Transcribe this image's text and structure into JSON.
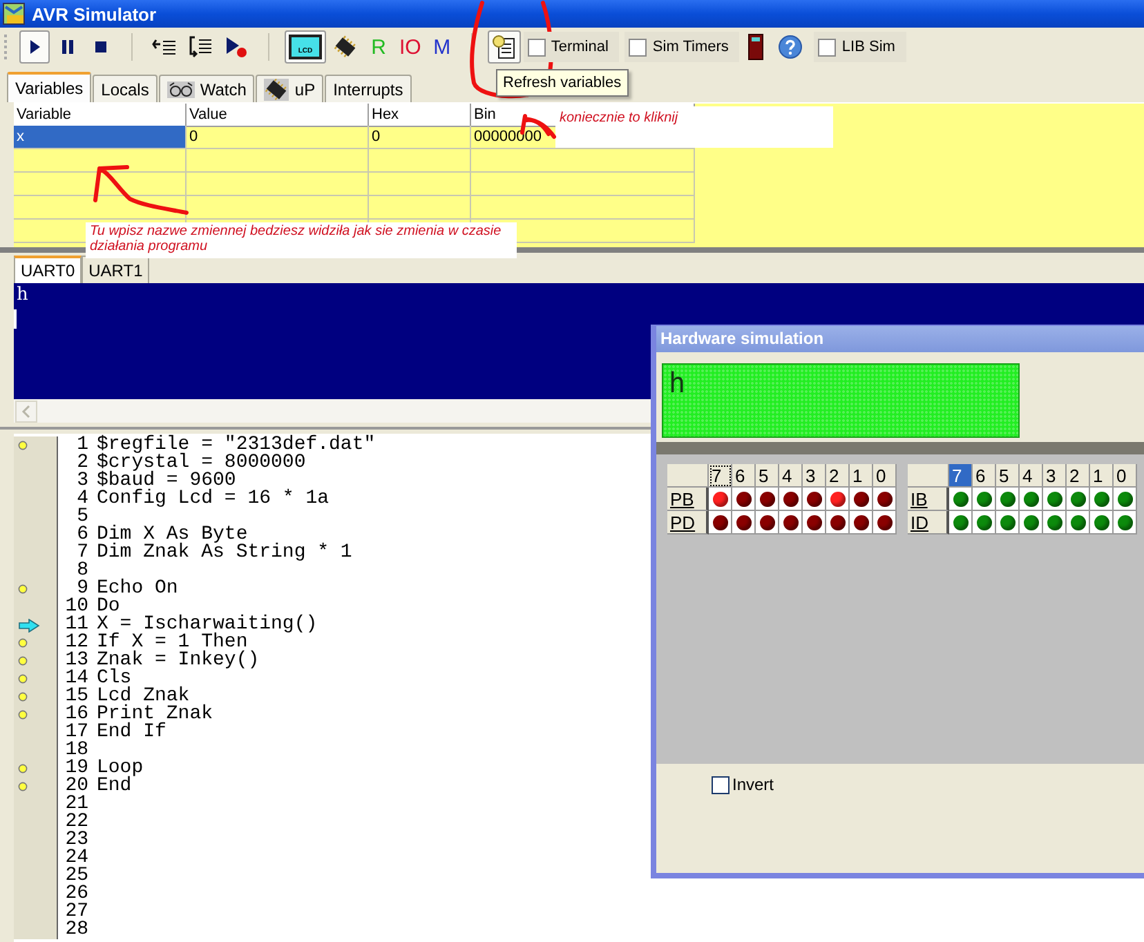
{
  "window": {
    "title": "AVR Simulator"
  },
  "toolbar": {
    "items": [
      {
        "kind": "run",
        "pressed": true
      },
      {
        "kind": "pause",
        "pressed": false
      },
      {
        "kind": "stop",
        "pressed": false
      },
      {
        "kind": "separator"
      },
      {
        "kind": "step-over",
        "pressed": false
      },
      {
        "kind": "step-into",
        "pressed": false
      },
      {
        "kind": "run-to",
        "pressed": false
      },
      {
        "kind": "separator"
      },
      {
        "kind": "lcd",
        "pressed": true,
        "label": "LCD"
      },
      {
        "kind": "chip",
        "pressed": false
      },
      {
        "kind": "letter",
        "label": "R",
        "color": "#22bb22"
      },
      {
        "kind": "letter",
        "label": "IO",
        "color": "#dd1133"
      },
      {
        "kind": "letter",
        "label": "M",
        "color": "#2233cc"
      },
      {
        "kind": "separator"
      },
      {
        "kind": "refresh",
        "pressed": true
      },
      {
        "kind": "checkbox",
        "label": "Terminal",
        "checked": false
      },
      {
        "kind": "checkbox",
        "label": "Sim Timers",
        "checked": false
      },
      {
        "kind": "door"
      },
      {
        "kind": "help"
      },
      {
        "kind": "checkbox",
        "label": "LIB Sim",
        "checked": false
      }
    ]
  },
  "tooltip": "Refresh variables",
  "tabs": [
    {
      "label": "Variables",
      "selected": true,
      "kind": "plain"
    },
    {
      "label": "Locals",
      "selected": false,
      "kind": "plain"
    },
    {
      "label": "Watch",
      "selected": false,
      "kind": "glasses"
    },
    {
      "label": "uP",
      "selected": false,
      "kind": "chip"
    },
    {
      "label": "Interrupts",
      "selected": false,
      "kind": "plain"
    }
  ],
  "variables": {
    "columns": [
      "Variable",
      "Value",
      "Hex",
      "Bin"
    ],
    "rows": [
      {
        "cells": [
          "x",
          "0",
          "0",
          "00000000"
        ],
        "selected": true
      }
    ]
  },
  "notes": [
    "koniecznie  to kliknij",
    "Tu wpisz nazwe zmiennej  bedziesz widziła jak sie zmienia w czasie działania programu"
  ],
  "uart_tabs": [
    {
      "label": "UART0",
      "selected": true
    },
    {
      "label": "UART1",
      "selected": false
    }
  ],
  "terminal": {
    "lines": [
      "h"
    ]
  },
  "editor": {
    "lines": [
      {
        "number": "1",
        "code": "$regfile = \"2313def.dat\"",
        "breakpoint": true,
        "current": false
      },
      {
        "number": "2",
        "code": "$crystal = 8000000",
        "breakpoint": false,
        "current": false
      },
      {
        "number": "3",
        "code": "$baud = 9600",
        "breakpoint": false,
        "current": false
      },
      {
        "number": "4",
        "code": "Config Lcd = 16 * 1a",
        "breakpoint": false,
        "current": false
      },
      {
        "number": "5",
        "breakpoint": false,
        "current": false
      },
      {
        "number": "6",
        "code": "Dim X As Byte",
        "breakpoint": false,
        "current": false
      },
      {
        "number": "7",
        "code": "Dim Znak As String * 1",
        "breakpoint": false,
        "current": false
      },
      {
        "number": "8",
        "breakpoint": false,
        "current": false
      },
      {
        "number": "9",
        "code": "Echo On",
        "breakpoint": true,
        "current": false
      },
      {
        "number": "10",
        "code": "Do",
        "breakpoint": false,
        "current": false
      },
      {
        "number": "11",
        "code": "X = Ischarwaiting()",
        "breakpoint": false,
        "current": true
      },
      {
        "number": "12",
        "code": "If X = 1 Then",
        "breakpoint": true,
        "current": false
      },
      {
        "number": "13",
        "code": "Znak = Inkey()",
        "breakpoint": true,
        "current": false
      },
      {
        "number": "14",
        "code": "Cls",
        "breakpoint": true,
        "current": false
      },
      {
        "number": "15",
        "code": "Lcd Znak",
        "breakpoint": true,
        "current": false
      },
      {
        "number": "16",
        "code": "Print Znak",
        "breakpoint": true,
        "current": false
      },
      {
        "number": "17",
        "code": "End If",
        "breakpoint": false,
        "current": false
      },
      {
        "number": "18",
        "breakpoint": false,
        "current": false
      },
      {
        "number": "19",
        "code": "Loop",
        "breakpoint": true,
        "current": false
      },
      {
        "number": "20",
        "code": "End",
        "breakpoint": true,
        "current": false
      },
      {
        "number": "21",
        "breakpoint": false,
        "current": false
      },
      {
        "number": "22",
        "breakpoint": false,
        "current": false
      },
      {
        "number": "23",
        "breakpoint": false,
        "current": false
      },
      {
        "number": "24",
        "breakpoint": false,
        "current": false
      },
      {
        "number": "25",
        "breakpoint": false,
        "current": false
      },
      {
        "number": "26",
        "breakpoint": false,
        "current": false
      },
      {
        "number": "27",
        "breakpoint": false,
        "current": false
      },
      {
        "number": "28",
        "breakpoint": false,
        "current": false
      }
    ]
  },
  "hardware": {
    "title": "Hardware simulation",
    "lcd_text": "h",
    "ports": [
      {
        "kind": "output",
        "columns": [
          {
            "label": "7",
            "selected": false,
            "focused": true
          },
          {
            "label": "6",
            "selected": false,
            "focused": false
          },
          {
            "label": "5",
            "selected": false,
            "focused": false
          },
          {
            "label": "4",
            "selected": false,
            "focused": false
          },
          {
            "label": "3",
            "selected": false,
            "focused": false
          },
          {
            "label": "2",
            "selected": false,
            "focused": false
          },
          {
            "label": "1",
            "selected": false,
            "focused": false
          },
          {
            "label": "0",
            "selected": false,
            "focused": false
          }
        ],
        "rows": [
          {
            "name": "PB",
            "leds": [
              true,
              false,
              false,
              false,
              false,
              true,
              false,
              false
            ]
          },
          {
            "name": "PD",
            "leds": [
              false,
              false,
              false,
              false,
              false,
              false,
              false,
              false
            ]
          }
        ]
      },
      {
        "kind": "input",
        "columns": [
          {
            "label": "7",
            "selected": true,
            "focused": false
          },
          {
            "label": "6",
            "selected": false,
            "focused": false
          },
          {
            "label": "5",
            "selected": false,
            "focused": false
          },
          {
            "label": "4",
            "selected": false,
            "focused": false
          },
          {
            "label": "3",
            "selected": false,
            "focused": false
          },
          {
            "label": "2",
            "selected": false,
            "focused": false
          },
          {
            "label": "1",
            "selected": false,
            "focused": false
          },
          {
            "label": "0",
            "selected": false,
            "focused": false
          }
        ],
        "rows": [
          {
            "name": "IB",
            "leds": [
              true,
              true,
              true,
              true,
              true,
              true,
              true,
              true
            ]
          },
          {
            "name": "ID",
            "leds": [
              true,
              true,
              true,
              true,
              true,
              true,
              true,
              true
            ]
          }
        ]
      }
    ],
    "invert": {
      "label": "Invert",
      "checked": false
    }
  }
}
